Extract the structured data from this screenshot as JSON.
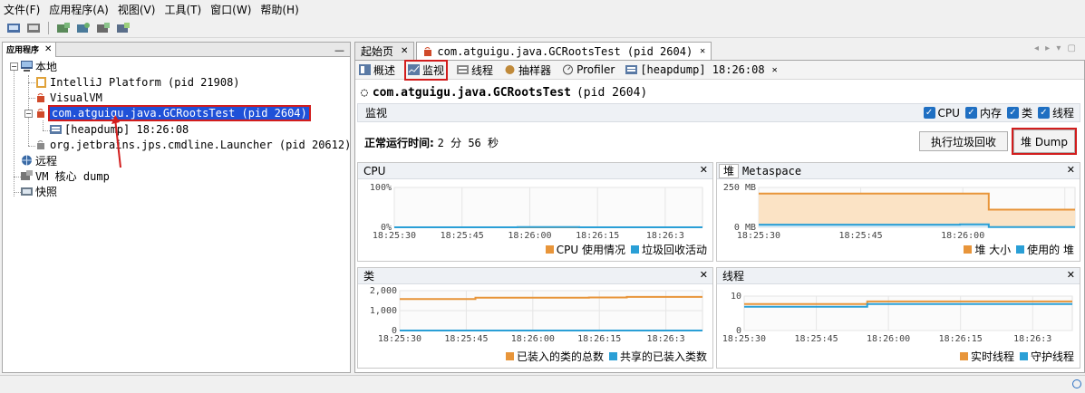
{
  "menubar": [
    "文件(F)",
    "应用程序(A)",
    "视图(V)",
    "工具(T)",
    "窗口(W)",
    "帮助(H)"
  ],
  "left": {
    "tab_label": "应用程序",
    "tree": {
      "local": "本地",
      "intellij": "IntelliJ Platform (pid 21908)",
      "visualvm": "VisualVM",
      "gcroots": "com.atguigu.java.GCRootsTest (pid 2604)",
      "heapdump": "[heapdump] 18:26:08",
      "launcher": "org.jetbrains.jps.cmdline.Launcher (pid 20612)",
      "remote": "远程",
      "coredump": "VM 核心 dump",
      "snapshot": "快照"
    }
  },
  "doc_tabs": {
    "start": "起始页",
    "app": "com.atguigu.java.GCRootsTest (pid 2604)"
  },
  "sub_tabs": {
    "overview": "概述",
    "monitor": "监视",
    "threads": "线程",
    "sampler": "抽样器",
    "profiler": "Profiler",
    "heapdump": "[heapdump] 18:26:08"
  },
  "app_title": "com.atguigu.java.GCRootsTest",
  "app_pid": "(pid 2604)",
  "monitor": {
    "label": "监视",
    "checks": [
      "CPU",
      "内存",
      "类",
      "线程"
    ],
    "uptime_label": "正常运行时间:",
    "uptime_value": "2 分 56 秒",
    "gc_button": "执行垃圾回收",
    "heapdump_button": "堆 Dump"
  },
  "chart_data": [
    {
      "type": "line",
      "title": "CPU",
      "x": [
        "18:25:30",
        "18:25:45",
        "18:26:00",
        "18:26:15",
        "18:26:3"
      ],
      "yticks": [
        "100%",
        "0%"
      ],
      "ylim": [
        0,
        100
      ],
      "series": [
        {
          "name": "CPU 使用情况",
          "color": "#e8953a",
          "values": [
            0,
            0,
            0,
            0,
            0,
            0
          ]
        },
        {
          "name": "垃圾回收活动",
          "color": "#2a9fd6",
          "values": [
            0,
            0,
            0.5,
            0,
            0,
            0
          ]
        }
      ],
      "legend": "bottom-right"
    },
    {
      "type": "area",
      "tabs": [
        "堆",
        "Metaspace"
      ],
      "x": [
        "18:25:30",
        "18:25:45",
        "18:26:00"
      ],
      "yticks": [
        "250 MB",
        "0 MB"
      ],
      "ylim": [
        0,
        300
      ],
      "series": [
        {
          "name": "堆 大小",
          "color": "#e8953a",
          "values": [
            254,
            254,
            254,
            254,
            254,
            254,
            254,
            254,
            133,
            133,
            133,
            133
          ]
        },
        {
          "name": "使用的 堆",
          "color": "#2a9fd6",
          "values": [
            20,
            20,
            20,
            20,
            20,
            20,
            20,
            22,
            2,
            2,
            2,
            2
          ]
        }
      ],
      "legend": "bottom-right"
    },
    {
      "type": "line",
      "title": "类",
      "x": [
        "18:25:30",
        "18:25:45",
        "18:26:00",
        "18:26:15",
        "18:26:3"
      ],
      "yticks": [
        "2,000",
        "1,000",
        "0"
      ],
      "ylim": [
        0,
        2000
      ],
      "series": [
        {
          "name": "已装入的类的总数",
          "color": "#e8953a",
          "values": [
            1580,
            1580,
            1650,
            1650,
            1650,
            1660,
            1690,
            1690,
            1690
          ]
        },
        {
          "name": "共享的已装入类数",
          "color": "#2a9fd6",
          "values": [
            0,
            0,
            0,
            0,
            0,
            0,
            0,
            0,
            0
          ]
        }
      ],
      "legend": "bottom-right"
    },
    {
      "type": "line",
      "title": "线程",
      "x": [
        "18:25:30",
        "18:25:45",
        "18:26:00",
        "18:26:15",
        "18:26:3"
      ],
      "yticks": [
        "10",
        "0"
      ],
      "ylim": [
        0,
        13
      ],
      "series": [
        {
          "name": "实时线程",
          "color": "#e8953a",
          "values": [
            10,
            10,
            10,
            11,
            11,
            11,
            11,
            11,
            11
          ]
        },
        {
          "name": "守护线程",
          "color": "#2a9fd6",
          "values": [
            9,
            9,
            9,
            10,
            10,
            10,
            10,
            10,
            10
          ]
        }
      ],
      "legend": "bottom-right"
    }
  ]
}
